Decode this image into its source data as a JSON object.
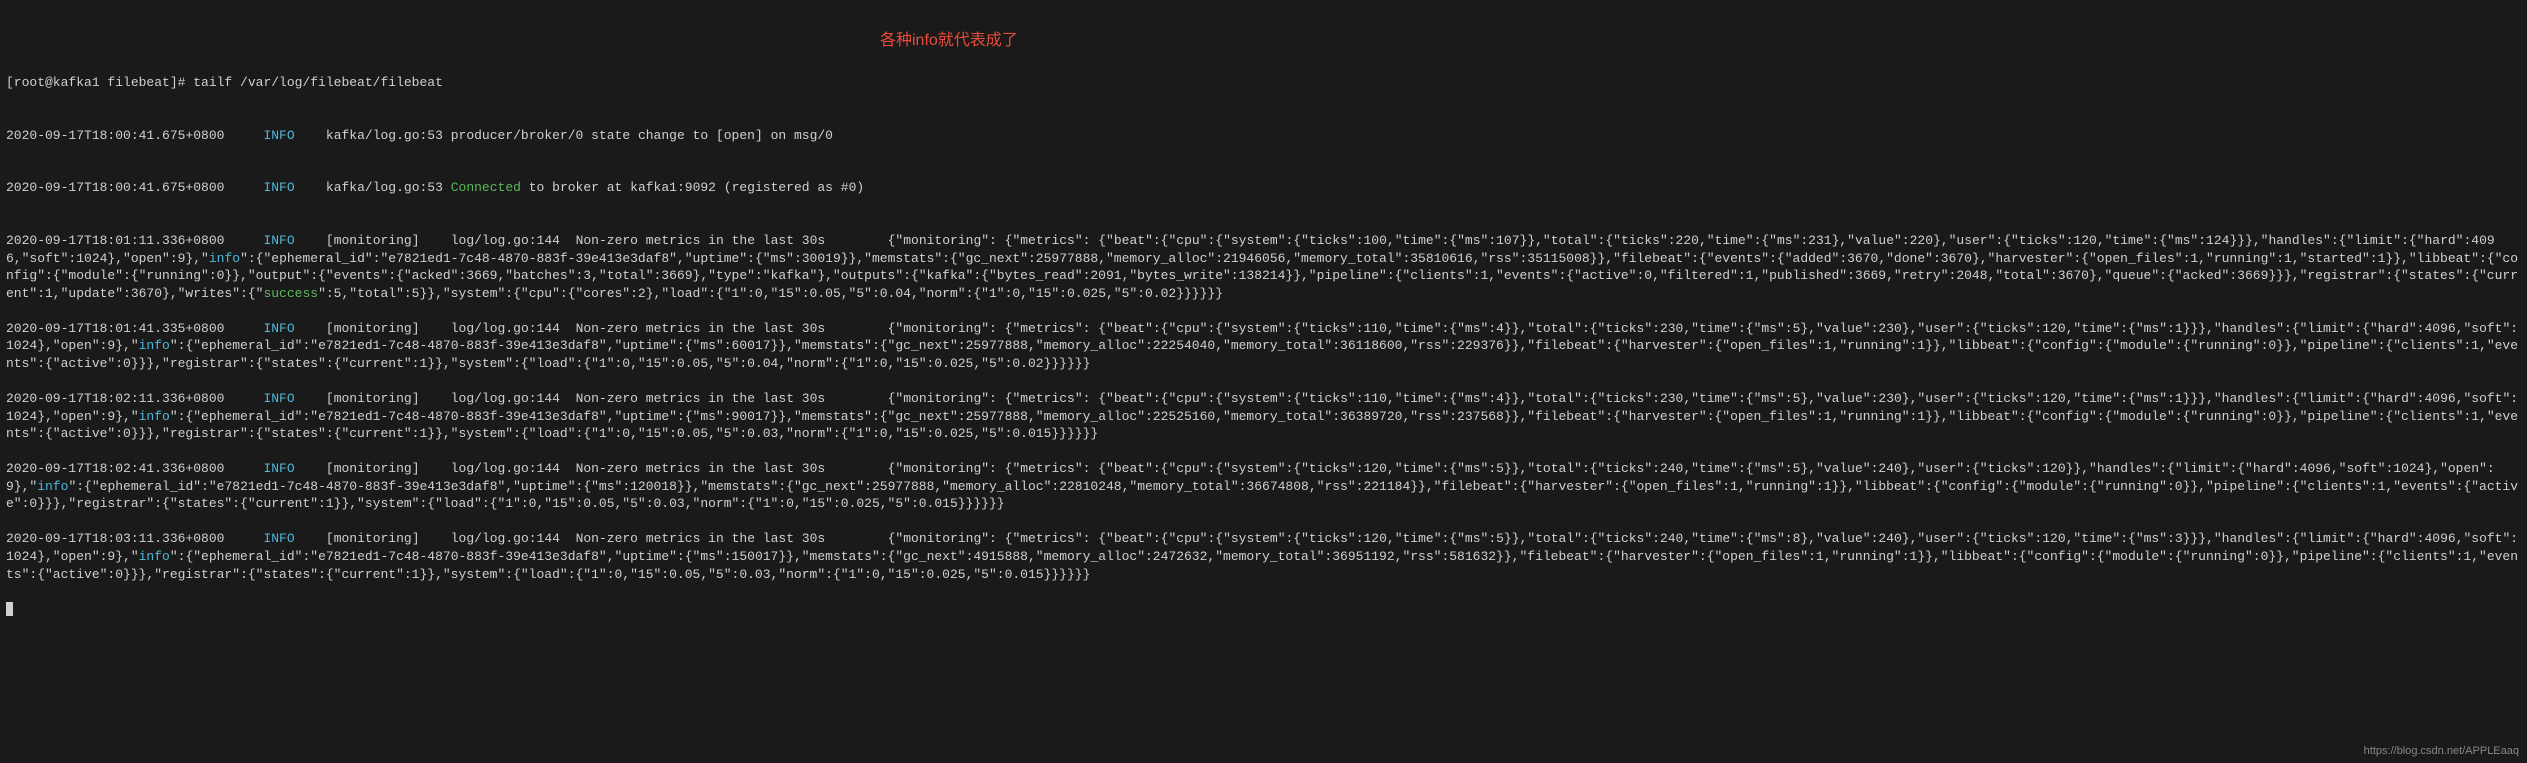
{
  "prompt": "[root@kafka1 filebeat]# tailf /var/log/filebeat/filebeat",
  "annotation": "各种info就代表成了",
  "watermark": "https://blog.csdn.net/APPLEaaq",
  "lines": {
    "l1_ts": "2020-09-17T18:00:41.675+0800",
    "l1_level": "INFO",
    "l1_body": "kafka/log.go:53 producer/broker/0 state change to [open] on msg/0",
    "l2_ts": "2020-09-17T18:00:41.675+0800",
    "l2_level": "INFO",
    "l2_prefix": "kafka/log.go:53 ",
    "l2_connected": "Connected",
    "l2_suffix": " to broker at kafka1:9092 (registered as #0)",
    "l3_ts": "2020-09-17T18:01:11.336+0800",
    "l3_level": "INFO",
    "l3_mon": "[monitoring]",
    "l3_src": "log/log.go:144",
    "l3_msg": "Non-zero metrics in the last 30s",
    "l3_json_a": "{\"monitoring\": {\"metrics\": {\"beat\":{\"cpu\":{\"system\":{\"ticks\":100,\"time\":{\"ms\":107}},\"total\":{\"ticks\":220,\"time\":{\"ms\":231},\"value\":220},\"user\":{\"ticks\":120,\"time\":{\"ms\":124}}},\"handles\":{\"limit\":{\"hard\":4096,\"soft\":1024},\"open\":9},\"",
    "l3_info_key": "info",
    "l3_json_b": "\":{\"ephemeral_id\":\"e7821ed1-7c48-4870-883f-39e413e3daf8\",\"uptime\":{\"ms\":30019}},\"memstats\":{\"gc_next\":25977888,\"memory_alloc\":21946056,\"memory_total\":35810616,\"rss\":35115008}},\"filebeat\":{\"events\":{\"added\":3670,\"done\":3670},\"harvester\":{\"open_files\":1,\"running\":1,\"started\":1}},\"libbeat\":{\"config\":{\"module\":{\"running\":0}},\"output\":{\"events\":{\"acked\":3669,\"batches\":3,\"total\":3669},\"type\":\"kafka\"},\"outputs\":{\"kafka\":{\"bytes_read\":2091,\"bytes_write\":138214}},\"pipeline\":{\"clients\":1,\"events\":{\"active\":0,\"filtered\":1,\"published\":3669,\"retry\":2048,\"total\":3670},\"queue\":{\"acked\":3669}}},\"registrar\":{\"states\":{\"current\":1,\"update\":3670},\"writes\":{\"",
    "l3_success": "success",
    "l3_json_c": "\":5,\"total\":5}},\"system\":{\"cpu\":{\"cores\":2},\"load\":{\"1\":0,\"15\":0.05,\"5\":0.04,\"norm\":{\"1\":0,\"15\":0.025,\"5\":0.02}}}}}}",
    "l4_ts": "2020-09-17T18:01:41.335+0800",
    "l4_level": "INFO",
    "l4_mon": "[monitoring]",
    "l4_src": "log/log.go:144",
    "l4_msg": "Non-zero metrics in the last 30s",
    "l4_json_a": "{\"monitoring\": {\"metrics\": {\"beat\":{\"cpu\":{\"system\":{\"ticks\":110,\"time\":{\"ms\":4}},\"total\":{\"ticks\":230,\"time\":{\"ms\":5},\"value\":230},\"user\":{\"ticks\":120,\"time\":{\"ms\":1}}},\"handles\":{\"limit\":{\"hard\":4096,\"soft\":1024},\"open\":9},\"",
    "l4_info_key": "info",
    "l4_json_b": "\":{\"ephemeral_id\":\"e7821ed1-7c48-4870-883f-39e413e3daf8\",\"uptime\":{\"ms\":60017}},\"memstats\":{\"gc_next\":25977888,\"memory_alloc\":22254040,\"memory_total\":36118600,\"rss\":229376}},\"filebeat\":{\"harvester\":{\"open_files\":1,\"running\":1}},\"libbeat\":{\"config\":{\"module\":{\"running\":0}},\"pipeline\":{\"clients\":1,\"events\":{\"active\":0}}},\"registrar\":{\"states\":{\"current\":1}},\"system\":{\"load\":{\"1\":0,\"15\":0.05,\"5\":0.04,\"norm\":{\"1\":0,\"15\":0.025,\"5\":0.02}}}}}}",
    "l5_ts": "2020-09-17T18:02:11.336+0800",
    "l5_level": "INFO",
    "l5_mon": "[monitoring]",
    "l5_src": "log/log.go:144",
    "l5_msg": "Non-zero metrics in the last 30s",
    "l5_json_a": "{\"monitoring\": {\"metrics\": {\"beat\":{\"cpu\":{\"system\":{\"ticks\":110,\"time\":{\"ms\":4}},\"total\":{\"ticks\":230,\"time\":{\"ms\":5},\"value\":230},\"user\":{\"ticks\":120,\"time\":{\"ms\":1}}},\"handles\":{\"limit\":{\"hard\":4096,\"soft\":1024},\"open\":9},\"",
    "l5_info_key": "info",
    "l5_json_b": "\":{\"ephemeral_id\":\"e7821ed1-7c48-4870-883f-39e413e3daf8\",\"uptime\":{\"ms\":90017}},\"memstats\":{\"gc_next\":25977888,\"memory_alloc\":22525160,\"memory_total\":36389720,\"rss\":237568}},\"filebeat\":{\"harvester\":{\"open_files\":1,\"running\":1}},\"libbeat\":{\"config\":{\"module\":{\"running\":0}},\"pipeline\":{\"clients\":1,\"events\":{\"active\":0}}},\"registrar\":{\"states\":{\"current\":1}},\"system\":{\"load\":{\"1\":0,\"15\":0.05,\"5\":0.03,\"norm\":{\"1\":0,\"15\":0.025,\"5\":0.015}}}}}}",
    "l6_ts": "2020-09-17T18:02:41.336+0800",
    "l6_level": "INFO",
    "l6_mon": "[monitoring]",
    "l6_src": "log/log.go:144",
    "l6_msg": "Non-zero metrics in the last 30s",
    "l6_json_a": "{\"monitoring\": {\"metrics\": {\"beat\":{\"cpu\":{\"system\":{\"ticks\":120,\"time\":{\"ms\":5}},\"total\":{\"ticks\":240,\"time\":{\"ms\":5},\"value\":240},\"user\":{\"ticks\":120}},\"handles\":{\"limit\":{\"hard\":4096,\"soft\":1024},\"open\":9},\"",
    "l6_info_key": "info",
    "l6_json_b": "\":{\"ephemeral_id\":\"e7821ed1-7c48-4870-883f-39e413e3daf8\",\"uptime\":{\"ms\":120018}},\"memstats\":{\"gc_next\":25977888,\"memory_alloc\":22810248,\"memory_total\":36674808,\"rss\":221184}},\"filebeat\":{\"harvester\":{\"open_files\":1,\"running\":1}},\"libbeat\":{\"config\":{\"module\":{\"running\":0}},\"pipeline\":{\"clients\":1,\"events\":{\"active\":0}}},\"registrar\":{\"states\":{\"current\":1}},\"system\":{\"load\":{\"1\":0,\"15\":0.05,\"5\":0.03,\"norm\":{\"1\":0,\"15\":0.025,\"5\":0.015}}}}}}",
    "l7_ts": "2020-09-17T18:03:11.336+0800",
    "l7_level": "INFO",
    "l7_mon": "[monitoring]",
    "l7_src": "log/log.go:144",
    "l7_msg": "Non-zero metrics in the last 30s",
    "l7_json_a": "{\"monitoring\": {\"metrics\": {\"beat\":{\"cpu\":{\"system\":{\"ticks\":120,\"time\":{\"ms\":5}},\"total\":{\"ticks\":240,\"time\":{\"ms\":8},\"value\":240},\"user\":{\"ticks\":120,\"time\":{\"ms\":3}}},\"handles\":{\"limit\":{\"hard\":4096,\"soft\":1024},\"open\":9},\"",
    "l7_info_key": "info",
    "l7_json_b": "\":{\"ephemeral_id\":\"e7821ed1-7c48-4870-883f-39e413e3daf8\",\"uptime\":{\"ms\":150017}},\"memstats\":{\"gc_next\":4915888,\"memory_alloc\":2472632,\"memory_total\":36951192,\"rss\":581632}},\"filebeat\":{\"harvester\":{\"open_files\":1,\"running\":1}},\"libbeat\":{\"config\":{\"module\":{\"running\":0}},\"pipeline\":{\"clients\":1,\"events\":{\"active\":0}}},\"registrar\":{\"states\":{\"current\":1}},\"system\":{\"load\":{\"1\":0,\"15\":0.05,\"5\":0.03,\"norm\":{\"1\":0,\"15\":0.025,\"5\":0.015}}}}}}"
  }
}
